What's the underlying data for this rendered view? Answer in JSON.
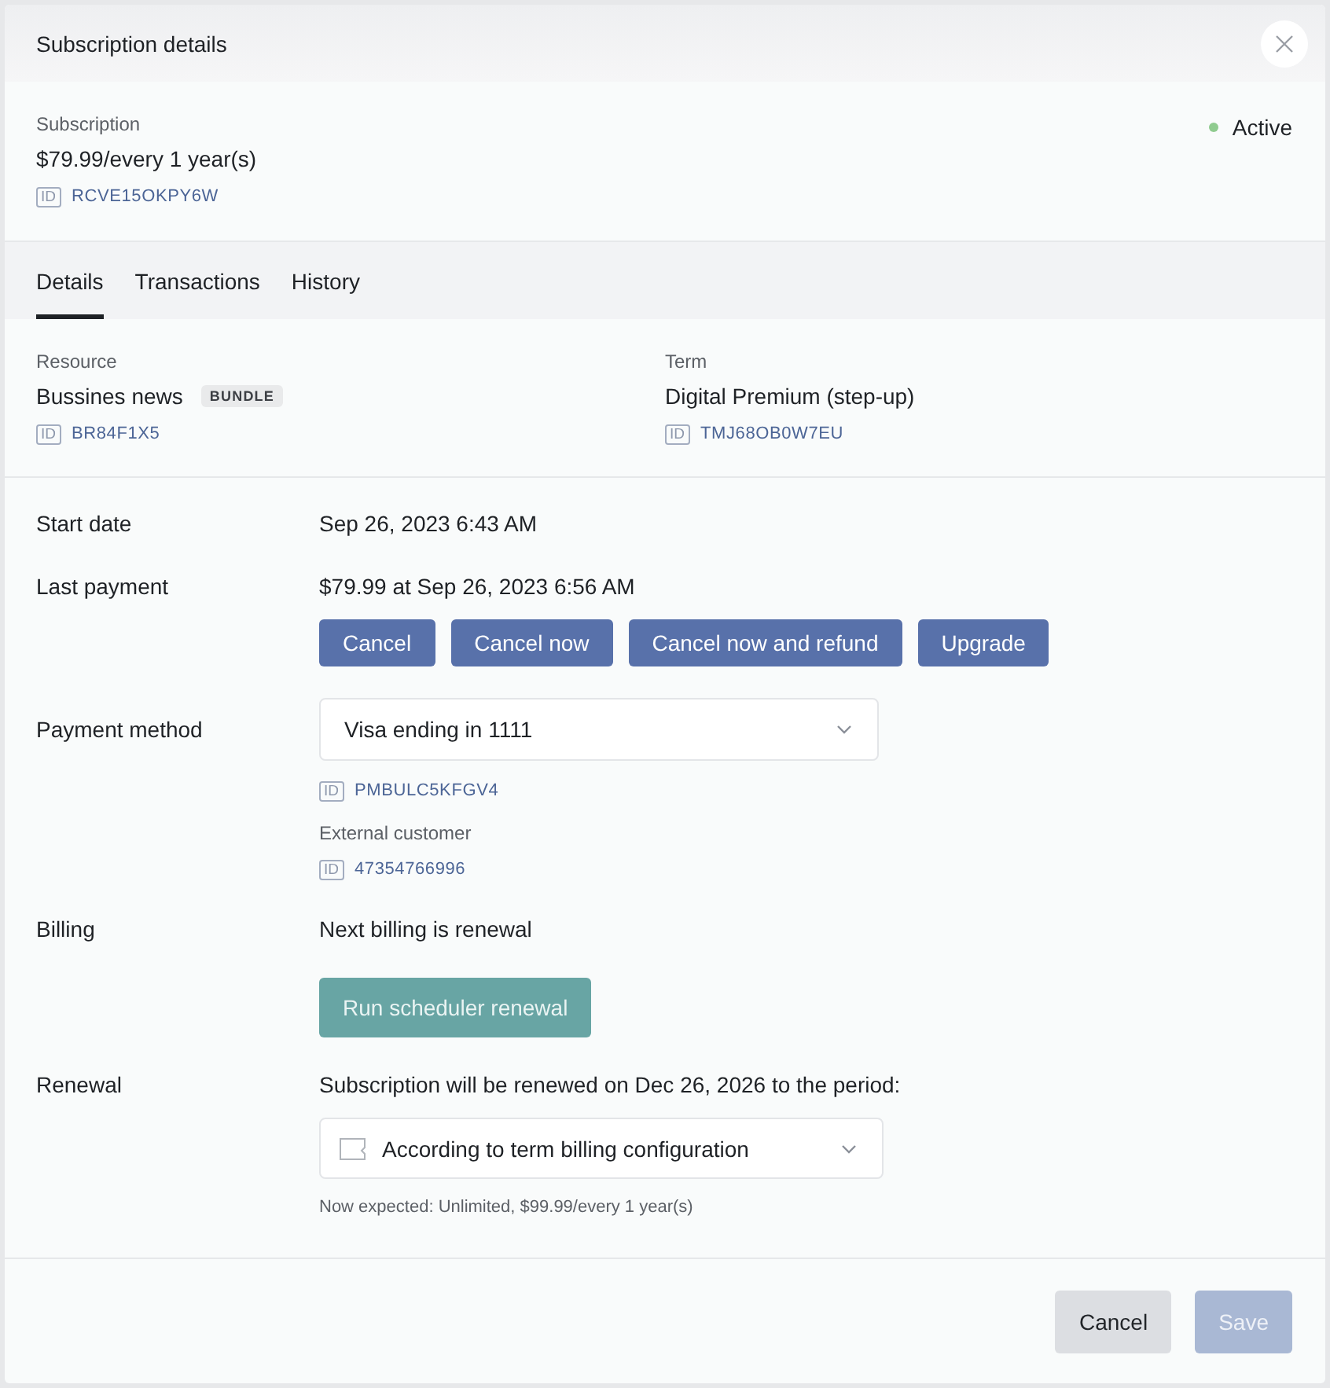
{
  "dialog": {
    "title": "Subscription details"
  },
  "subscription": {
    "label": "Subscription",
    "price": "$79.99/every 1 year(s)",
    "id": {
      "tag": "ID",
      "value": "RCVE15OKPY6W"
    },
    "status": {
      "label": "Active",
      "color": "#8fcb8f"
    }
  },
  "tabs": [
    {
      "label": "Details",
      "selected": true
    },
    {
      "label": "Transactions",
      "selected": false
    },
    {
      "label": "History",
      "selected": false
    }
  ],
  "items": [
    {
      "label": "Resource",
      "name": "Bussines news",
      "badge": "BUNDLE",
      "id": {
        "tag": "ID",
        "value": "BR84F1X5"
      }
    },
    {
      "label": "Term",
      "name": "Digital Premium (step-up)",
      "id": {
        "tag": "ID",
        "value": "TMJ68OB0W7EU"
      }
    }
  ],
  "rows": [
    {
      "label": "Start date",
      "value": "Sep 26, 2023 6:43 AM"
    },
    {
      "label": "Last payment",
      "value": "$79.99 at Sep 26, 2023 6:56 AM",
      "buttons": [
        {
          "label": "Cancel"
        },
        {
          "label": "Cancel now"
        },
        {
          "label": "Cancel now and refund"
        },
        {
          "label": "Upgrade"
        }
      ]
    },
    {
      "label": "Payment method",
      "select": {
        "value": "Visa ending in 1111"
      },
      "ids": [
        {
          "tag": "ID",
          "value": "PMBULC5KFGV4"
        },
        {
          "caption": "External customer",
          "tag": "ID",
          "value": "47354766996"
        }
      ]
    },
    {
      "label": "Billing",
      "value": "Next billing is renewal",
      "action": {
        "label": "Run scheduler renewal"
      }
    },
    {
      "label": "Renewal",
      "value": "Subscription will be renewed on Dec 26, 2026 to the period:",
      "select": {
        "value": "According to term billing configuration",
        "icon": true
      },
      "note": "Now expected: Unlimited, $99.99/every 1 year(s)"
    }
  ],
  "footer": {
    "buttons": [
      {
        "label": "Cancel",
        "kind": "secondary",
        "disabled": false
      },
      {
        "label": "Save",
        "kind": "primary",
        "disabled": true
      }
    ]
  }
}
